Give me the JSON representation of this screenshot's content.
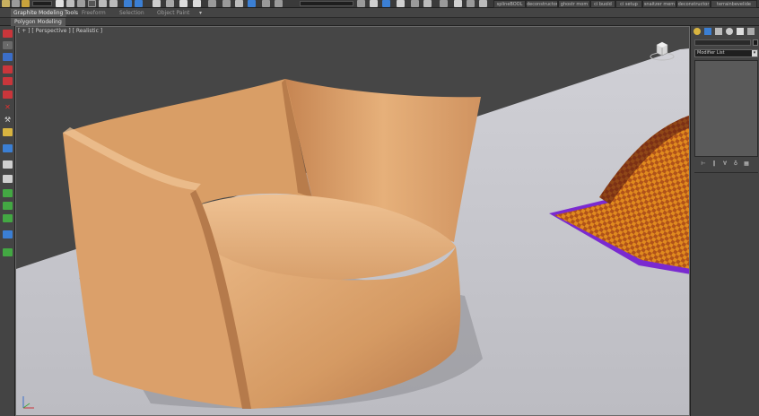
{
  "toolbar": {
    "buttons": [
      "splineBOOL",
      "deconstructor",
      "ghostr mom",
      "ci buold",
      "ci setup",
      "snaitzer mem",
      "deconstructor",
      "terrainbevelide"
    ]
  },
  "ribbon": {
    "tabs": [
      "Graphite Modeling Tools",
      "Freeform",
      "Selection",
      "Object Paint"
    ],
    "active_tab": 0,
    "panel_label": "Polygon Modeling",
    "dropdown_symbol": "▾"
  },
  "viewport": {
    "label": "[ + ] [ Perspective ] [ Realistic ]"
  },
  "command_panel": {
    "modifier_list": "Modifier List",
    "dropdown_symbol": "▾"
  },
  "colors": {
    "chair": "#d9a06c",
    "floor": "#c9c9cf",
    "background": "#464646",
    "rug_border": "#7a2ad0",
    "rug_check_a": "#e08a1e",
    "rug_check_b": "#b0521a"
  }
}
